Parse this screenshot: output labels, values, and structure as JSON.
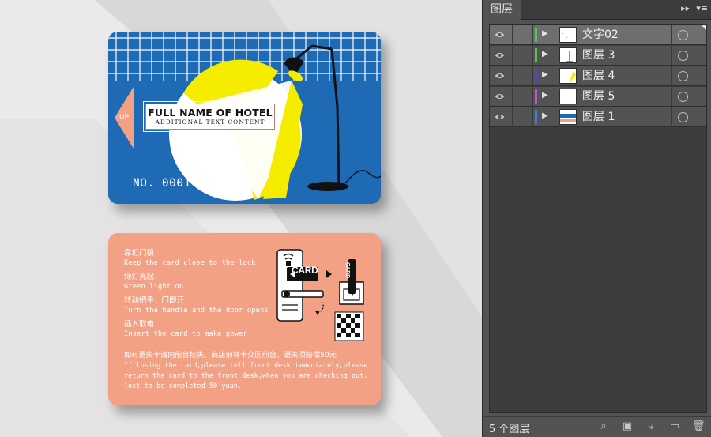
{
  "canvas": {
    "front_card": {
      "hotel_name": "FULL NAME OF HOTEL",
      "hotel_sub": "ADDITIONAL TEXT CONTENT",
      "up_label": "UP",
      "card_number": "NO. 00011",
      "colors": {
        "card": "#1e6ab4",
        "yellow": "#f5ec00",
        "arrow": "#f2a185"
      }
    },
    "back_card": {
      "instructions": [
        {
          "cn": "靠近门锁",
          "en": "Keep the card close to the lock"
        },
        {
          "cn": "绿灯亮起",
          "en": "Green light on"
        },
        {
          "cn": "转动把手，门即开",
          "en": "Turn the handle and the door opens"
        },
        {
          "cn": "插入取电",
          "en": "Insert the card to make power"
        }
      ],
      "lost_cn": "如有遗失卡请向前台挂失，商店前将卡交回前台，遗失须赔偿50元",
      "lost_en": [
        "If losing the card,please tell front desk immediately,please",
        "return the card to the front desk,when you are checking out.",
        "lost to be completed 50 yuan."
      ],
      "card_label": "CARD",
      "colors": {
        "card": "#f2a185"
      }
    }
  },
  "layers_panel": {
    "tab_title": "图层",
    "layers": [
      {
        "name": "文字02",
        "color": "#53c64f",
        "selected": true
      },
      {
        "name": "图层 3",
        "color": "#53c64f",
        "selected": false
      },
      {
        "name": "图层 4",
        "color": "#4a4ad8",
        "selected": false
      },
      {
        "name": "图层 5",
        "color": "#d04ad0",
        "selected": false
      },
      {
        "name": "图层 1",
        "color": "#3f7be0",
        "selected": false
      }
    ],
    "layer_count": "5 个图层"
  }
}
